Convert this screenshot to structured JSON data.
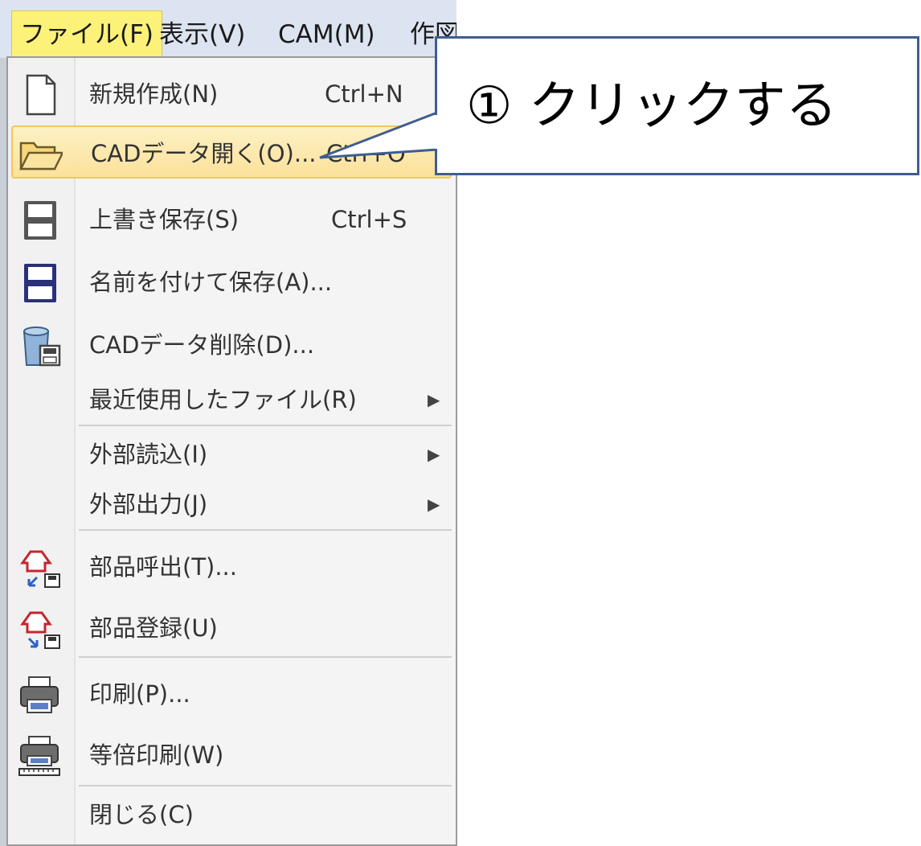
{
  "menubar": {
    "items": [
      {
        "label": "ファイル(F)"
      },
      {
        "label": "表示(V)"
      },
      {
        "label": "CAM(M)"
      },
      {
        "label": "作図"
      }
    ]
  },
  "file_menu": {
    "items": [
      {
        "label": "新規作成(N)",
        "shortcut": "Ctrl+N",
        "icon": "new-document-icon"
      },
      {
        "label": "CADデータ開く(O)...",
        "shortcut": "Ctrl+O",
        "icon": "folder-open-icon",
        "highlighted": true
      },
      {
        "label": "上書き保存(S)",
        "shortcut": "Ctrl+S",
        "icon": "save-icon"
      },
      {
        "label": "名前を付けて保存(A)...",
        "icon": "save-as-icon"
      },
      {
        "label": "CADデータ削除(D)...",
        "icon": "delete-data-icon"
      },
      {
        "label": "最近使用したファイル(R)",
        "submenu": true
      },
      {
        "label": "外部読込(I)",
        "submenu": true
      },
      {
        "label": "外部出力(J)",
        "submenu": true
      },
      {
        "label": "部品呼出(T)...",
        "icon": "part-call-icon"
      },
      {
        "label": "部品登録(U)",
        "icon": "part-register-icon"
      },
      {
        "label": "印刷(P)...",
        "icon": "printer-icon"
      },
      {
        "label": "等倍印刷(W)",
        "icon": "actual-size-print-icon"
      },
      {
        "label": "閉じる(C)"
      }
    ]
  },
  "callout": {
    "text": "① クリックする",
    "border_color": "#3f5d8f"
  },
  "colors": {
    "highlight": "#fbe19a",
    "menubar_bg": "#dde4f1"
  }
}
